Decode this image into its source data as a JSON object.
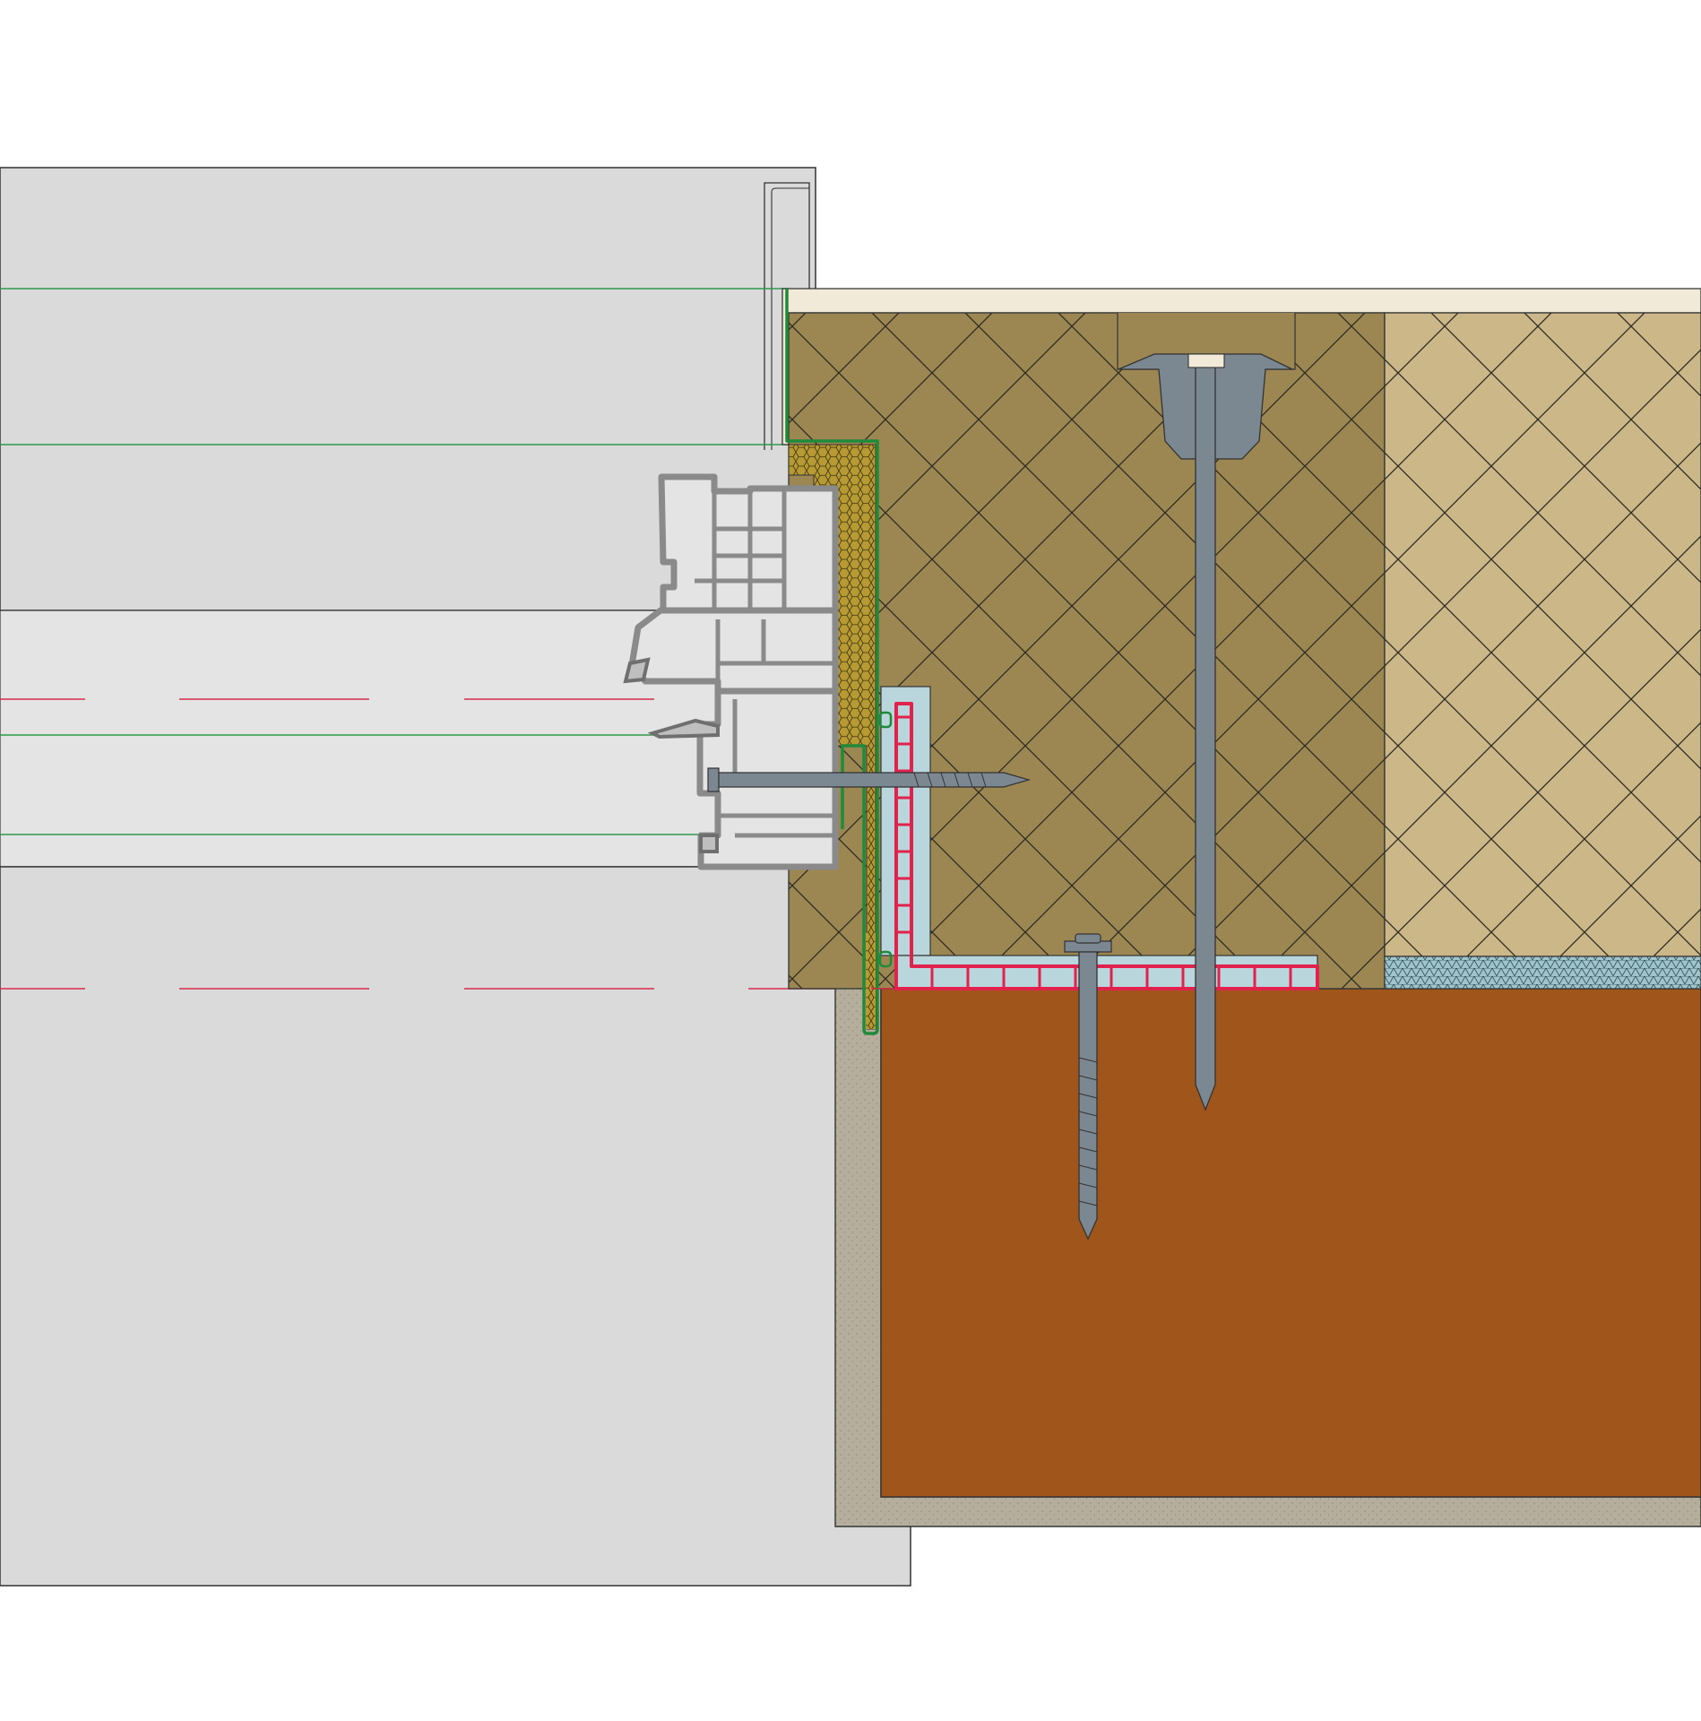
{
  "diagram": {
    "kind": "construction-section-detail",
    "background": "#ffffff",
    "colors": {
      "wall_panel": "#dadada",
      "wall_panel_light": "#e4e4e4",
      "outline": "#333333",
      "reveal_board": "#f2ead8",
      "insulation_dark": "#9c8752",
      "insulation_light": "#cbb788",
      "hatch": "#2d2a22",
      "masonry": "#a0561a",
      "render": "#b5ae9c",
      "sealing_foam": "#b79a33",
      "membrane_green": "#1f8a3a",
      "membrane_red": "#e0224c",
      "profile_blue": "#b9d6dc",
      "fixing_grey": "#7b8791",
      "window_frame": "#909090",
      "reference_green": "#2e9a4d",
      "reference_red": "#d92b4e",
      "mesh_blue": "#9fc4cc"
    },
    "components": [
      "interior-wall",
      "window-frame-profile",
      "reveal-board",
      "sealing-tape",
      "connection-membrane",
      "starter-track",
      "frame-screw",
      "insulation-anchor",
      "anchor-screw",
      "insulation-board-dark",
      "insulation-board-light",
      "reinforcement-mesh",
      "masonry-wall",
      "plaster-render"
    ]
  }
}
